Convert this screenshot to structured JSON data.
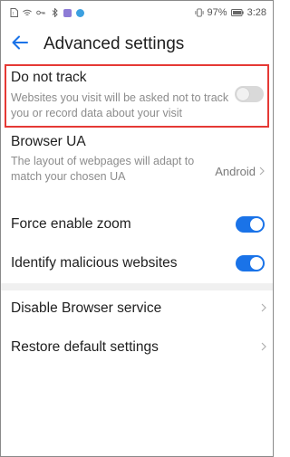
{
  "status_bar": {
    "battery": "97%",
    "time": "3:28"
  },
  "header": {
    "title": "Advanced settings"
  },
  "settings": {
    "do_not_track": {
      "title": "Do not track",
      "subtitle": "Websites you visit will be asked not to track you or record data about your visit",
      "enabled": false
    },
    "browser_ua": {
      "title": "Browser UA",
      "subtitle": "The layout of webpages will adapt to match your chosen UA",
      "value": "Android"
    },
    "force_zoom": {
      "title": "Force enable zoom",
      "enabled": true
    },
    "malicious_sites": {
      "title": "Identify malicious websites",
      "enabled": true
    },
    "disable_service": {
      "title": "Disable Browser service"
    },
    "restore_defaults": {
      "title": "Restore default settings"
    }
  },
  "colors": {
    "accent": "#1a73e8",
    "highlight_border": "#e53935"
  },
  "icons": [
    "sim-icon",
    "wifi-icon",
    "key-icon",
    "bluetooth-icon",
    "app-badge-icon",
    "browser-badge-icon",
    "vibrate-icon",
    "battery-icon",
    "back-arrow-icon",
    "chevron-right-icon"
  ]
}
